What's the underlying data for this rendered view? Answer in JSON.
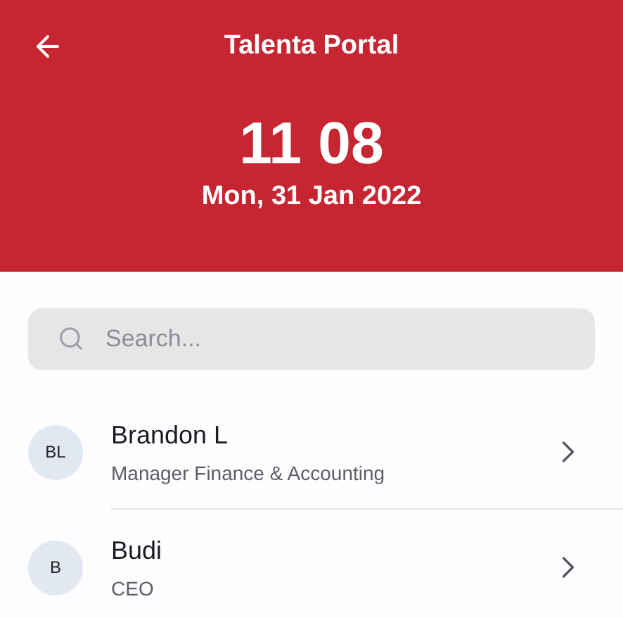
{
  "header": {
    "title": "Talenta Portal",
    "time": "11 08",
    "date": "Mon, 31 Jan 2022"
  },
  "search": {
    "placeholder": "Search..."
  },
  "employees": [
    {
      "initials": "BL",
      "name": "Brandon L",
      "position": "Manager Finance & Accounting"
    },
    {
      "initials": "B",
      "name": "Budi",
      "position": "CEO"
    }
  ]
}
